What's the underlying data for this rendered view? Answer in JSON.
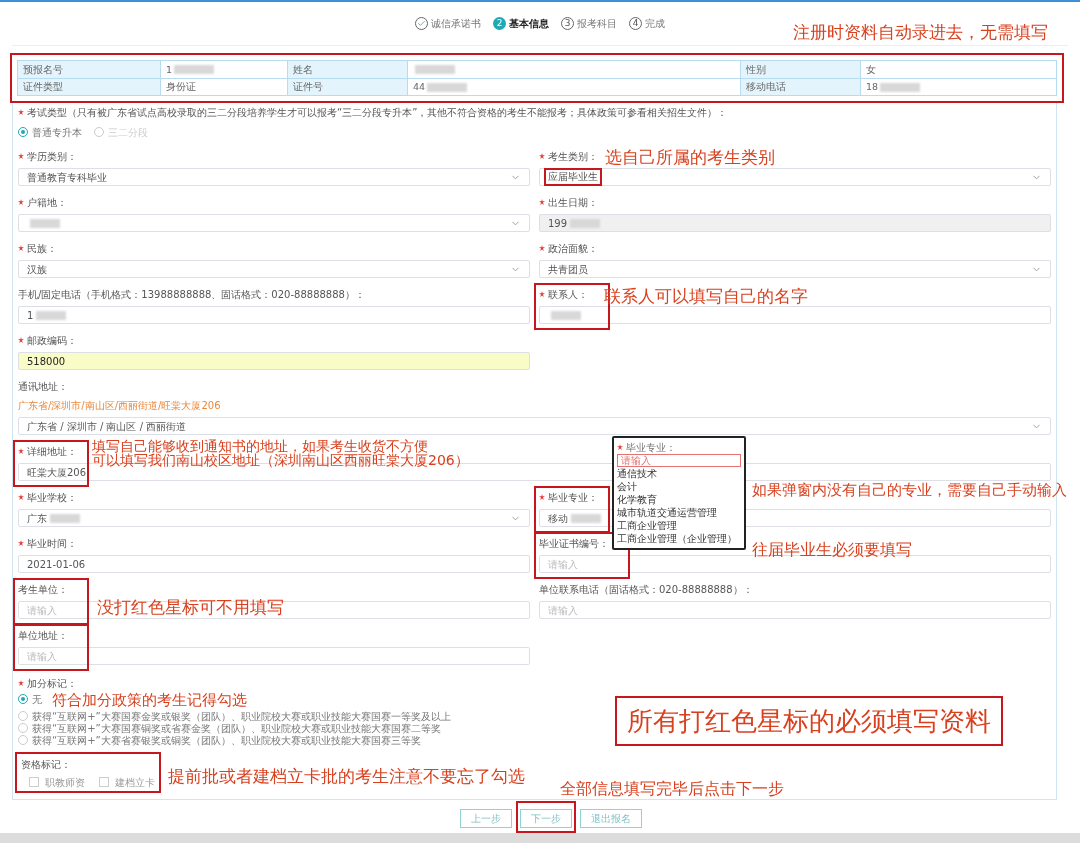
{
  "steps": [
    {
      "label": "诚信承诺书",
      "done": true,
      "selected": false
    },
    {
      "number": "2",
      "label": "基本信息",
      "done": false,
      "selected": true
    },
    {
      "number": "3",
      "label": "报考科目",
      "done": false,
      "selected": false
    },
    {
      "number": "4",
      "label": "完成",
      "done": false,
      "selected": false
    }
  ],
  "info_table": {
    "framed": true,
    "rows": [
      [
        {
          "label": "预报名号",
          "value": "1",
          "redacted": true
        },
        {
          "label": "姓名",
          "redacted": true
        },
        {
          "label": "性别",
          "value": "女",
          "redacted": false
        }
      ],
      [
        {
          "label": "证件类型",
          "value": "身份证",
          "redacted": false
        },
        {
          "label": "证件号",
          "value": "44",
          "redacted": true
        },
        {
          "label": "移动电话",
          "value": "18",
          "redacted": true
        }
      ]
    ]
  },
  "exam_type": {
    "label": "考试类型（只有被广东省试点高校录取的三二分段培养学生才可以报考“三二分段专升本”，其他不符合资格的考生不能报考；具体政策可参看相关招生文件）：",
    "required": true,
    "options": [
      {
        "label": "普通专升本",
        "selected": true,
        "disabled": false
      },
      {
        "label": "三二分段",
        "selected": false,
        "disabled": true
      }
    ]
  },
  "rows": [
    [
      {
        "label": "学历类别：",
        "required": true,
        "kind": "select",
        "value": "普通教育专科毕业",
        "redacted": false,
        "framed": false
      },
      {
        "label": "考生类别：",
        "required": true,
        "kind": "select",
        "value": "应届毕业生",
        "redacted": false,
        "framed": true
      }
    ],
    [
      {
        "label": "户籍地：",
        "required": true,
        "kind": "select",
        "redacted": true,
        "framed": false
      },
      {
        "label": "出生日期：",
        "required": true,
        "kind": "input",
        "value": "199",
        "redacted": true,
        "disabled": true,
        "framed": false
      }
    ],
    [
      {
        "label": "民族：",
        "required": true,
        "kind": "select",
        "value": "汉族",
        "redacted": false,
        "framed": false
      },
      {
        "label": "政治面貌：",
        "required": true,
        "kind": "select",
        "value": "共青团员",
        "redacted": false,
        "framed": false
      }
    ],
    [
      {
        "label": "手机/固定电话（手机格式：13988888888、固话格式：020-88888888）：",
        "required": false,
        "kind": "input",
        "value": "1",
        "redacted": true,
        "framed": false
      },
      {
        "label": "联系人：",
        "required": true,
        "kind": "input",
        "redacted": true,
        "framed": true
      }
    ],
    [
      {
        "label": "邮政编码：",
        "required": true,
        "kind": "input",
        "value": "518000",
        "redacted": false,
        "highlighted": true,
        "framed": false
      }
    ],
    [
      {
        "label": "通讯地址：",
        "required": false,
        "kind": "cascader",
        "wide": true,
        "summary": "广东省/深圳市/南山区/西丽街道/旺棠大厦206",
        "value": "广东省 / 深圳市 / 南山区 / 西丽街道",
        "redacted": false,
        "framed": false
      }
    ],
    [
      {
        "label": "详细地址：",
        "required": true,
        "kind": "input",
        "wide": true,
        "value": "旺棠大厦206",
        "redacted": false,
        "framed": true
      }
    ],
    [
      {
        "label": "毕业学校：",
        "required": true,
        "kind": "select",
        "value": "广东",
        "redacted": true,
        "framed": false
      },
      {
        "label": "毕业专业：",
        "required": true,
        "kind": "input",
        "value": "移动",
        "redacted": true,
        "framed": true
      }
    ],
    [
      {
        "label": "毕业时间：",
        "required": true,
        "kind": "input",
        "value": "2021-01-06",
        "redacted": false,
        "framed": false
      },
      {
        "label": "毕业证书编号：",
        "required": false,
        "kind": "input",
        "placeholder": "请输入",
        "framed": true
      }
    ],
    [
      {
        "label": "考生单位：",
        "required": false,
        "kind": "input",
        "placeholder": "请输入",
        "framed": true
      },
      {
        "label": "单位联系电话（固话格式：020-88888888）：",
        "required": false,
        "kind": "input",
        "placeholder": "请输入",
        "framed": false
      }
    ],
    [
      {
        "label": "单位地址：",
        "required": false,
        "kind": "input",
        "placeholder": "请输入",
        "framed": true
      }
    ]
  ],
  "bonus": {
    "label": "加分标记：",
    "required": true,
    "options": [
      {
        "label": "无",
        "selected": true
      },
      {
        "label": "获得“互联网+”大赛国赛金奖或银奖（团队）、职业院校大赛或职业技能大赛国赛一等奖及以上",
        "selected": false
      },
      {
        "label": "获得“互联网+”大赛国赛铜奖或省赛金奖（团队）、职业院校大赛或职业技能大赛国赛二等奖",
        "selected": false
      },
      {
        "label": "获得“互联网+”大赛省赛银奖或铜奖（团队）、职业院校大赛或职业技能大赛国赛三等奖",
        "selected": false
      }
    ]
  },
  "qualification": {
    "label": "资格标记：",
    "framed": true,
    "options": [
      {
        "label": "职教师资",
        "checked": false
      },
      {
        "label": "建档立卡",
        "checked": false
      }
    ]
  },
  "buttons": [
    {
      "label": "上一步",
      "framed": false
    },
    {
      "label": "下一步",
      "framed": true
    },
    {
      "label": "退出报名",
      "framed": false
    }
  ],
  "major_popup": {
    "label": "毕业专业：",
    "required": true,
    "placeholder": "请输入",
    "options": [
      "通信技术",
      "会计",
      "化学教育",
      "城市轨道交通运营管理",
      "工商企业管理",
      "工商企业管理（企业管理）"
    ]
  },
  "annotations": [
    {
      "kind": "note",
      "text": "注册时资料自动录进去，无需填写"
    },
    {
      "kind": "note",
      "text": "选自己所属的考生类别"
    },
    {
      "kind": "note",
      "text": "联系人可以填写自己的名字"
    },
    {
      "kind": "note",
      "text": "填写自己能够收到通知书的地址，如果考生收货不方便"
    },
    {
      "kind": "note",
      "text": "可以填写我们南山校区地址（深圳南山区西丽旺棠大厦206）"
    },
    {
      "kind": "note",
      "text": "如果弹窗内没有自己的专业，需要自己手动输入"
    },
    {
      "kind": "note",
      "text": "往届毕业生必须要填写"
    },
    {
      "kind": "note",
      "text": "没打红色星标可不用填写"
    },
    {
      "kind": "note",
      "text": "符合加分政策的考生记得勾选"
    },
    {
      "kind": "note",
      "text": "提前批或者建档立卡批的考生注意不要忘了勾选"
    },
    {
      "kind": "note",
      "text": "全部信息填写完毕后点击下一步"
    },
    {
      "kind": "boxed",
      "text": "所有打红色星标的必须填写资料"
    }
  ]
}
